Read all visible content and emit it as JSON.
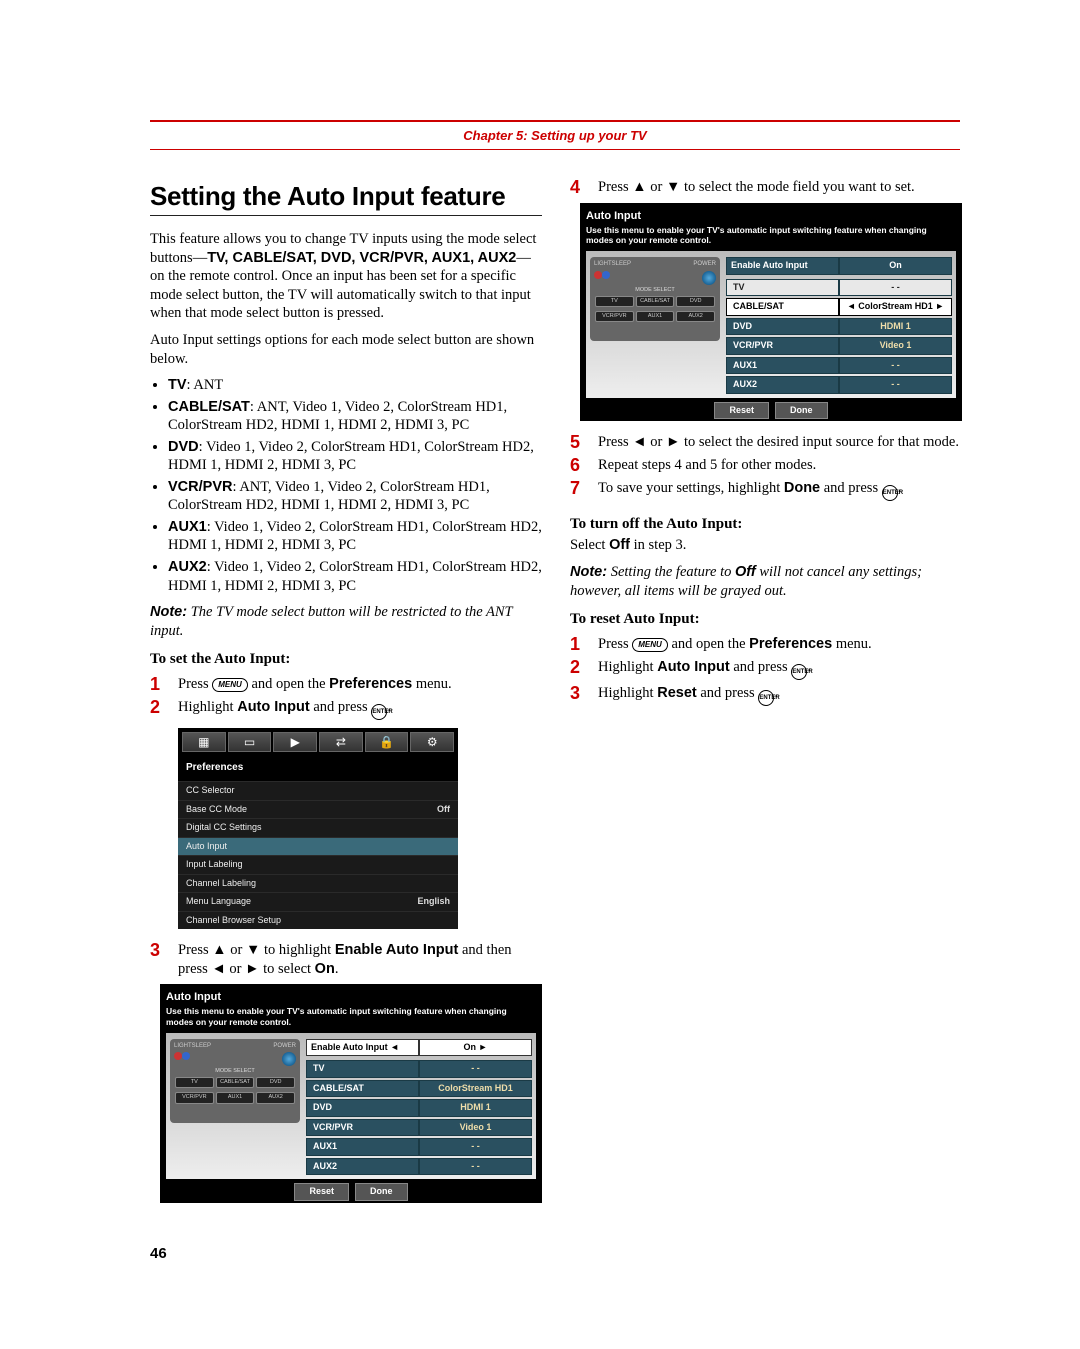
{
  "chapter": "Chapter 5: Setting up your TV",
  "title": "Setting the Auto Input feature",
  "intro1a": "This feature allows you to change TV inputs using the mode select buttons—",
  "intro1b": "TV, CABLE/SAT, DVD, VCR/PVR, AUX1, AUX2",
  "intro1c": "—on the remote control. Once an input has been set for a specific mode select button, the TV will automatically switch to that input when that mode select button is pressed.",
  "intro2": "Auto Input settings options for each mode select button are shown below.",
  "options": [
    {
      "k": "TV",
      "v": ": ANT"
    },
    {
      "k": "CABLE/SAT",
      "v": ": ANT, Video 1, Video 2, ColorStream HD1, ColorStream HD2, HDMI 1, HDMI 2, HDMI 3, PC"
    },
    {
      "k": "DVD",
      "v": ": Video 1, Video 2, ColorStream HD1, ColorStream HD2, HDMI 1, HDMI 2, HDMI 3, PC"
    },
    {
      "k": "VCR/PVR",
      "v": ": ANT, Video 1, Video 2, ColorStream HD1, ColorStream HD2, HDMI 1, HDMI 2, HDMI 3, PC"
    },
    {
      "k": "AUX1",
      "v": ": Video 1, Video 2, ColorStream HD1, ColorStream HD2, HDMI 1, HDMI 2, HDMI 3, PC"
    },
    {
      "k": "AUX2",
      "v": ": Video 1, Video 2, ColorStream HD1, ColorStream HD2, HDMI 1, HDMI 2, HDMI 3, PC"
    }
  ],
  "note1_label": "Note:",
  "note1": " The TV mode select button will be restricted to the ANT input.",
  "subhead_set": "To set the Auto Input:",
  "set_steps": {
    "s1a": "Press ",
    "s1menu": "MENU",
    "s1b": " and open the ",
    "s1c": "Preferences",
    "s1d": " menu.",
    "s2a": "Highlight ",
    "s2b": "Auto Input",
    "s2c": " and press ",
    "s2enter": "ENTER",
    "s2d": ".",
    "s3a": "Press ",
    "s3b": " or ",
    "s3c": " to highlight ",
    "s3d": "Enable Auto Input",
    "s3e": " and then press ",
    "s3f": " or ",
    "s3g": " to select ",
    "s3h": "On",
    "s3i": ".",
    "s4a": "Press ",
    "s4b": " or ",
    "s4c": " to select the mode field you want to set.",
    "s5a": "Press ",
    "s5b": " or ",
    "s5c": " to select the desired input source for that mode.",
    "s6": "Repeat steps 4 and 5 for other modes.",
    "s7a": "To save your settings, highlight ",
    "s7b": "Done",
    "s7c": " and press ",
    "s7enter": "ENTER",
    "s7d": "."
  },
  "turnoff_head": "To turn off the Auto Input:",
  "turnoff_body_a": "Select ",
  "turnoff_body_b": "Off",
  "turnoff_body_c": " in step 3.",
  "note2_label": "Note:",
  "note2a": " Setting the feature to ",
  "note2b": "Off",
  "note2c": " will not cancel any settings; however, all items will be grayed out.",
  "reset_head": "To reset Auto Input:",
  "reset_steps": {
    "r1a": "Press ",
    "r1menu": "MENU",
    "r1b": " and open the ",
    "r1c": "Preferences",
    "r1d": " menu.",
    "r2a": "Highlight ",
    "r2b": "Auto Input",
    "r2c": " and press ",
    "r2enter": "ENTER",
    "r2d": ".",
    "r3a": "Highlight ",
    "r3b": "Reset",
    "r3c": " and press ",
    "r3enter": "ENTER",
    "r3d": "."
  },
  "pref_menu": {
    "title": "Preferences",
    "icons": [
      "▦",
      "▭",
      "▶",
      "⇄",
      "🔒",
      "⚙"
    ],
    "rows": [
      {
        "k": "CC Selector",
        "v": ""
      },
      {
        "k": "Base CC Mode",
        "v": "Off"
      },
      {
        "k": "Digital CC Settings",
        "v": ""
      },
      {
        "k": "Auto Input",
        "v": "",
        "hl": true
      },
      {
        "k": "Input Labeling",
        "v": ""
      },
      {
        "k": "Channel Labeling",
        "v": ""
      },
      {
        "k": "Menu Language",
        "v": "English"
      },
      {
        "k": "Channel Browser Setup",
        "v": ""
      }
    ]
  },
  "ai_panel": {
    "title": "Auto Input",
    "sub": "Use this menu to enable your TV's automatic input switching feature when changing modes on your remote control.",
    "head_a": "Enable Auto Input",
    "head_b": "On",
    "rows1": [
      {
        "m": "TV",
        "v": "- -"
      },
      {
        "m": "CABLE/SAT",
        "v": "ColorStream HD1"
      },
      {
        "m": "DVD",
        "v": "HDMI 1"
      },
      {
        "m": "VCR/PVR",
        "v": "Video 1"
      },
      {
        "m": "AUX1",
        "v": "- -"
      },
      {
        "m": "AUX2",
        "v": "- -"
      }
    ],
    "rows2": [
      {
        "m": "TV",
        "v": "- -",
        "sel": true
      },
      {
        "m": "CABLE/SAT",
        "v": "ColorStream HD1",
        "hl": true,
        "arrows": true
      },
      {
        "m": "DVD",
        "v": "HDMI 1"
      },
      {
        "m": "VCR/PVR",
        "v": "Video 1"
      },
      {
        "m": "AUX1",
        "v": "- -"
      },
      {
        "m": "AUX2",
        "v": "- -"
      }
    ],
    "btn_reset": "Reset",
    "btn_done": "Done",
    "remote": {
      "top": [
        "LIGHT",
        "SLEEP",
        "POWER"
      ],
      "mode_label": "MODE SELECT",
      "r1": [
        "TV",
        "CABLE/SAT",
        "DVD"
      ],
      "r2": [
        "VCR/PVR",
        "AUX1",
        "AUX2"
      ]
    }
  },
  "page_num": "46"
}
